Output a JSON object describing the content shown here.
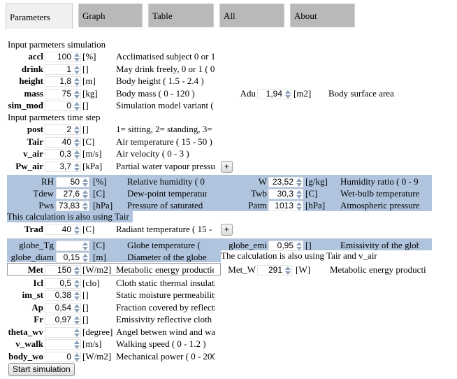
{
  "tabs": [
    {
      "label": "Parameters",
      "active": true
    },
    {
      "label": "Graph",
      "active": false
    },
    {
      "label": "Table",
      "active": false
    },
    {
      "label": "All",
      "active": false
    },
    {
      "label": "About",
      "active": false
    }
  ],
  "sim_section": {
    "title": "Input parmeters simulation",
    "rows": [
      {
        "name": "accl",
        "value": "100",
        "unit": "[%]",
        "desc": "Acclimatised subject 0 or 1"
      },
      {
        "name": "drink",
        "value": "1",
        "unit": "[]",
        "desc": "May drink freely, 0 or 1 ( 0"
      },
      {
        "name": "height",
        "value": "1,8",
        "unit": "[m]",
        "desc": "Body height ( 1.5 - 2.4 )"
      },
      {
        "name": "mass",
        "value": "75",
        "unit": "[kg]",
        "desc": "Body mass ( 0 - 120 )"
      },
      {
        "name": "sim_mod",
        "value": "0",
        "unit": "[]",
        "desc": "Simulation model variant ("
      }
    ],
    "adu": {
      "name": "Adu",
      "value": "1,94",
      "unit": "[m2]",
      "desc": "Body surface area"
    }
  },
  "time_section": {
    "title": "Input parmeters time step",
    "rows": [
      {
        "name": "post",
        "value": "2",
        "unit": "[]",
        "desc": "1= sitting, 2= standing, 3="
      },
      {
        "name": "Tair",
        "value": "40",
        "unit": "[C]",
        "desc": "Air temperature ( 15 - 50 )"
      },
      {
        "name": "v_air",
        "value": "0,3",
        "unit": "[m/s]",
        "desc": "Air velocity ( 0 - 3 )"
      },
      {
        "name": "Pw_air",
        "value": "3,7",
        "unit": "[kPa]",
        "desc": "Partial water vapour pressure"
      }
    ],
    "expand_label": "+"
  },
  "humidity_panel": {
    "left": [
      {
        "name": "RH",
        "value": "50",
        "unit": "[%]",
        "desc": "Relative humidity ( 0"
      },
      {
        "name": "Tdew",
        "value": "27,6",
        "unit": "[C]",
        "desc": "Dew-point temperature"
      },
      {
        "name": "Pws",
        "value": "73,83",
        "unit": "[hPa]",
        "desc": "Pressure of saturated"
      }
    ],
    "right": [
      {
        "name": "W",
        "value": "23,52",
        "unit": "[g/kg]",
        "desc": "Humidity ratio ( 0 - 9"
      },
      {
        "name": "Twb",
        "value": "30,3",
        "unit": "[C]",
        "desc": "Wet-bulb temperature"
      },
      {
        "name": "Patm",
        "value": "1013",
        "unit": "[hPa]",
        "desc": "Atmospheric pressure"
      }
    ],
    "note": "This calculation is also using Tair"
  },
  "trad": {
    "name": "Trad",
    "value": "40",
    "unit": "[C]",
    "desc": "Radiant temperature ( 15 -",
    "expand_label": "+"
  },
  "globe_panel": {
    "left": [
      {
        "name": "globe_Tg",
        "value": "",
        "unit": "[C]",
        "desc": "Globe temperature ("
      },
      {
        "name": "globe_diam",
        "value": "0,15",
        "unit": "[m]",
        "desc": "Diameter of the globe"
      }
    ],
    "right": {
      "name": "globe_emi",
      "value": "0,95",
      "unit": "[]",
      "desc": "Emissivity of the globe"
    },
    "note": "The calculation is also using Tair and v_air"
  },
  "met": {
    "name": "Met",
    "value": "150",
    "unit": "[W/m2]",
    "desc": "Metabolic energy production"
  },
  "met_w": {
    "name": "Met_W",
    "value": "291",
    "unit": "[W]",
    "desc": "Metabolic energy producti"
  },
  "clothing_rows": [
    {
      "name": "Icl",
      "value": "0,5",
      "unit": "[clo]",
      "desc": "Cloth static thermal insulation"
    },
    {
      "name": "im_st",
      "value": "0,38",
      "unit": "[]",
      "desc": "Static moisture permeability"
    },
    {
      "name": "Ap",
      "value": "0,54",
      "unit": "[]",
      "desc": "Fraction covered by reflective"
    },
    {
      "name": "Fr",
      "value": "0,97",
      "unit": "[]",
      "desc": "Emissivity reflective cloth"
    },
    {
      "name": "theta_wv",
      "value": "",
      "unit": "[degree]",
      "desc": "Angel betwen wind and walking"
    },
    {
      "name": "v_walk",
      "value": "",
      "unit": "[m/s]",
      "desc": "Walking speed ( 0 - 1.2 )"
    },
    {
      "name": "body_wo",
      "value": "0",
      "unit": "[W/m2]",
      "desc": "Mechanical power ( 0 - 200"
    }
  ],
  "start_button": "Start simulation"
}
